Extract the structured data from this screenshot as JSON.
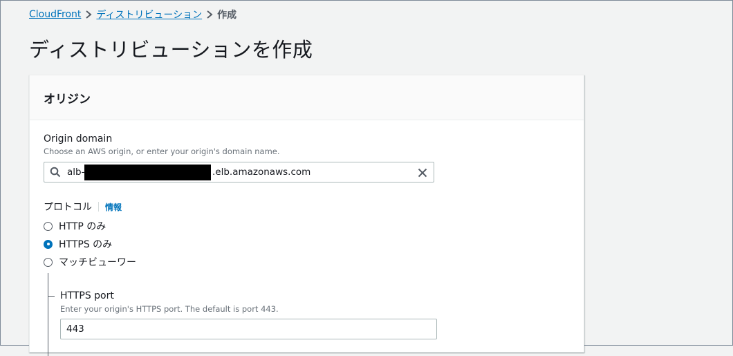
{
  "breadcrumb": {
    "items": [
      "CloudFront",
      "ディストリビューション"
    ],
    "current": "作成"
  },
  "page": {
    "title": "ディストリビューションを作成"
  },
  "origin_section": {
    "title": "オリジン",
    "origin_domain": {
      "label": "Origin domain",
      "description": "Choose an AWS origin, or enter your origin's domain name.",
      "value_prefix": "alb-",
      "value_suffix": ".elb.amazonaws.com"
    },
    "protocol": {
      "label": "プロトコル",
      "info_link": "情報",
      "options": [
        "HTTP のみ",
        "HTTPS のみ",
        "マッチビューワー"
      ],
      "selected": "HTTPS のみ"
    },
    "https_port": {
      "label": "HTTPS port",
      "description": "Enter your origin's HTTPS port. The default is port 443.",
      "value": "443"
    }
  },
  "colors": {
    "link": "#0073bb",
    "text": "#16191f",
    "muted": "#687078",
    "page_bg": "#f2f3f3"
  },
  "icons": {
    "breadcrumb_separator": "chevron-right-icon",
    "search": "search-icon",
    "clear": "close-icon"
  }
}
